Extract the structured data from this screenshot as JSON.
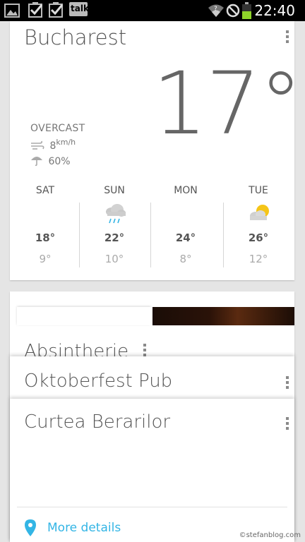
{
  "status_bar": {
    "time": "22:40",
    "notification_icons": [
      "image-icon",
      "checkbox-icon",
      "checkbox-icon",
      "talk-icon"
    ],
    "talk_label": "talk",
    "system_icons": [
      "wifi-icon",
      "blocked-icon",
      "battery-icon"
    ],
    "battery_color": "#8fd42a"
  },
  "weather": {
    "city": "Bucharest",
    "temperature": "17°",
    "condition": "OVERCAST",
    "wind_value": "8",
    "wind_unit": "km/h",
    "rain_chance": "60%",
    "forecast": [
      {
        "day": "SAT",
        "icon": "none",
        "high": "18°",
        "low": "9°"
      },
      {
        "day": "SUN",
        "icon": "rain-cloud-icon",
        "high": "22°",
        "low": "10°"
      },
      {
        "day": "MON",
        "icon": "none",
        "high": "24°",
        "low": "8°"
      },
      {
        "day": "TUE",
        "icon": "partly-cloudy-icon",
        "high": "26°",
        "low": "12°"
      }
    ]
  },
  "places": [
    {
      "name": "Absintherie"
    },
    {
      "name": "Oktoberfest Pub"
    },
    {
      "name": "Curtea Berarilor"
    }
  ],
  "more_details": "More details",
  "watermark": "©stefanblog.com",
  "colors": {
    "accent": "#33b5e5",
    "sun": "#f5c518"
  }
}
